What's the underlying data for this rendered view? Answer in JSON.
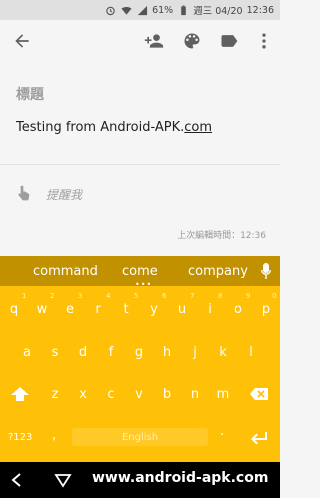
{
  "status_bar": {
    "battery": "61%",
    "date": "週三 04/20",
    "time": "12:36",
    "icons": [
      "alarm-icon",
      "wifi-icon",
      "signal-icon",
      "battery-icon"
    ]
  },
  "toolbar": {
    "icons": [
      "back-arrow-icon",
      "add-person-icon",
      "palette-icon",
      "label-icon",
      "more-vert-icon"
    ]
  },
  "note": {
    "title_placeholder": "標題",
    "body_text_prefix": "Testing from Android-APK.",
    "body_text_link": "com",
    "remind_placeholder": "提醒我",
    "remind_icon": "pointer-hand-icon",
    "last_edited": "上次編輯時間：12:36"
  },
  "keyboard": {
    "colors": {
      "keyboard": "#ffc107",
      "suggestion_bar": "#c29100"
    },
    "suggestions": [
      "command",
      "come",
      "company"
    ],
    "suggestions_more": "•••",
    "row1": [
      "q",
      "w",
      "e",
      "r",
      "t",
      "y",
      "u",
      "i",
      "o",
      "p"
    ],
    "row1_numbers": [
      "1",
      "2",
      "3",
      "4",
      "5",
      "6",
      "7",
      "8",
      "9",
      "0"
    ],
    "row2": [
      "a",
      "s",
      "d",
      "f",
      "g",
      "h",
      "j",
      "k",
      "l"
    ],
    "row3": [
      "z",
      "x",
      "c",
      "v",
      "b",
      "n",
      "m"
    ],
    "symbols_label": "?123",
    "comma": ",",
    "space_label": "English",
    "period": ".",
    "icons": [
      "mic-icon",
      "shift-icon",
      "backspace-icon",
      "enter-icon"
    ]
  },
  "nav_bar": {
    "watermark": "www.android-apk.com",
    "icons": [
      "back-triangle-icon"
    ]
  }
}
